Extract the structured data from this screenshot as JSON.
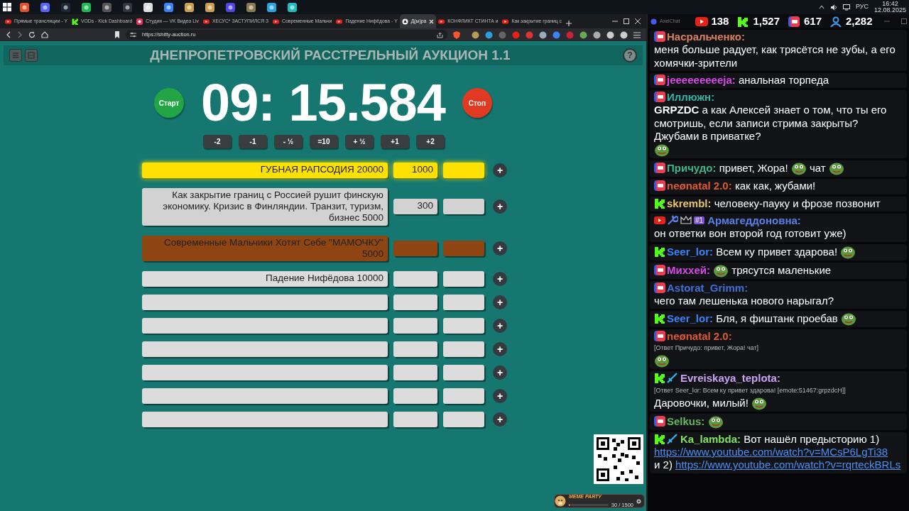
{
  "taskbar": {
    "tray": {
      "language": "РУС",
      "time": "16:42",
      "date": "12.08.2025"
    }
  },
  "browser": {
    "tabs": [
      {
        "kind": "youtube",
        "title": "Прямые трансляции - Y",
        "selected": false
      },
      {
        "kind": "kick",
        "title": "VODs - Kick Dashboard",
        "selected": false
      },
      {
        "kind": "vk",
        "title": "Студия — VK Видео Liv",
        "selected": false
      },
      {
        "kind": "youtube",
        "title": "ХЕСУС* ЗАСТУПИЛСЯ З",
        "selected": false
      },
      {
        "kind": "youtube",
        "title": "Современные Мальчи",
        "selected": false
      },
      {
        "kind": "youtube",
        "title": "Падение Нифёдова - Y",
        "selected": false
      },
      {
        "kind": "page",
        "title": "Д(ы)ра",
        "selected": true
      },
      {
        "kind": "youtube",
        "title": "КОНФЛИКТ СТИНТА и",
        "selected": false
      },
      {
        "kind": "youtube",
        "title": "Как закрытие границ с",
        "selected": false
      }
    ],
    "url": "https://shitty-auction.ru"
  },
  "auction": {
    "title": "ДНЕПРОПЕТРОВСКИЙ РАССТРЕЛЬНЫЙ АУКЦИОН 1.1",
    "help": "?",
    "start_button": "Старт",
    "timer": "09: 15.584",
    "stop_button": "Стоп",
    "time_buttons": [
      "-2",
      "-1",
      "- ½",
      "=10",
      "+ ½",
      "+1",
      "+2"
    ],
    "lots": [
      {
        "name": "ГУБНАЯ РАПСОДИЯ 20000",
        "amount": "1000",
        "color": "#ffe100",
        "add": "+"
      },
      {
        "name": "Как закрытие границ с Россией рушит финскую экономику. Кризис в Финляндии. Транзит, туризм, бизнес 5000",
        "amount": "300",
        "color": "#d2d2d2",
        "add": "+"
      },
      {
        "name": "Современные Мальчики Хотят Себе \"МАМОЧКУ\" 5000",
        "color": "#8f4512",
        "add": "+"
      },
      {
        "name": "Падение Нифёдова 10000",
        "color": "#dcdcdc",
        "add": "+"
      },
      {
        "color": "#dcdcdc",
        "add": "+"
      },
      {
        "color": "#dcdcdc",
        "add": "+"
      },
      {
        "color": "#dcdcdc",
        "add": "+"
      },
      {
        "color": "#dcdcdc",
        "add": "+"
      },
      {
        "color": "#dcdcdc",
        "add": "+"
      },
      {
        "color": "#dcdcdc",
        "add": "+"
      }
    ]
  },
  "widget": {
    "title": "MEME PARTY",
    "progress": "30 / 1500",
    "level": 0.02
  },
  "chat": {
    "title": "AxelChat",
    "stats": [
      {
        "kind": "youtube",
        "count": "138"
      },
      {
        "kind": "kick",
        "count": "1,527"
      },
      {
        "kind": "live",
        "count": "617"
      },
      {
        "kind": "viewers",
        "count": "2,282"
      }
    ],
    "messages": [
      {
        "kind": "live",
        "author": "Насральченко:",
        "color": "#d9805f",
        "parts": [
          {
            "kind": "text",
            "text": "меня больше радует, как трясётся не зубы, а его хомячки-зрители"
          }
        ]
      },
      {
        "kind": "live",
        "author": "jeeeeeeeeeja:",
        "color": "#d64be8",
        "parts": [
          {
            "kind": "text",
            "text": "анальная торпеда"
          }
        ]
      },
      {
        "kind": "live",
        "author": "Иллюжн:",
        "color": "#2fb5a2",
        "parts": [
          {
            "kind": "text",
            "text": "**GRPZDC** а как Алексей знает о том, что ты его смотришь, если записи стрима закрыты? Джубами в приватке?"
          },
          {
            "kind": "emote"
          }
        ]
      },
      {
        "kind": "live",
        "author": "Причудо:",
        "color": "#3fb68b",
        "parts": [
          {
            "kind": "text",
            "text": "привет, Жора!"
          },
          {
            "kind": "emote"
          },
          {
            "kind": "text",
            "text": "чат"
          },
          {
            "kind": "emote"
          }
        ]
      },
      {
        "kind": "live",
        "author": "neønatal 2.0:",
        "color": "#e0582e",
        "parts": [
          {
            "kind": "text",
            "text": "как как, жубами!"
          }
        ]
      },
      {
        "kind": "kick",
        "author": "skrembl:",
        "color": "#e8c46a",
        "parts": [
          {
            "kind": "text",
            "text": "человеку-пауку и фрозе позвонит"
          }
        ]
      },
      {
        "kind": "youtube",
        "author": "Армагеддоновна:",
        "color": "#5b7fe8",
        "badges": [
          {
            "kind": "wrench"
          },
          {
            "kind": "crown"
          },
          {
            "kind": "rank",
            "text": "#1"
          }
        ],
        "parts": [
          {
            "kind": "text",
            "text": "он ответки вон второй год готовит уже)"
          }
        ]
      },
      {
        "kind": "kick",
        "author": "Seer_lor:",
        "color": "#3b82f6",
        "parts": [
          {
            "kind": "text",
            "text": "Всем ку привет здарова!"
          },
          {
            "kind": "emote"
          }
        ]
      },
      {
        "kind": "live",
        "author": "Михxей:",
        "color": "#d64be8",
        "parts": [
          {
            "kind": "emote"
          },
          {
            "kind": "text",
            "text": "трясутся маленькие"
          }
        ]
      },
      {
        "kind": "live",
        "author": "Astorat_Grimm:",
        "color": "#3f70d8",
        "parts": [
          {
            "kind": "text",
            "text": "чего там лешенька нового нарыгал?"
          }
        ]
      },
      {
        "kind": "kick",
        "author": "Seer_lor:",
        "color": "#3b82f6",
        "parts": [
          {
            "kind": "text",
            "text": "Бля, я фиштанк проебав"
          },
          {
            "kind": "emote"
          }
        ]
      },
      {
        "kind": "live",
        "author": "neønatal 2.0:",
        "color": "#e0582e",
        "reply": "[Ответ Причудо: привет, Жора! чат]",
        "parts": [
          {
            "kind": "emote"
          }
        ]
      },
      {
        "kind": "kick",
        "author": "Evreiskaya_teplota:",
        "color": "#c9a3f2",
        "badges": [
          {
            "kind": "sword"
          }
        ],
        "reply": "[Ответ Seer_lor: Всем ку привет здарова! [emote:51467:grpzdcH]]",
        "parts": [
          {
            "kind": "text",
            "text": "Даровочки, милый!"
          },
          {
            "kind": "emote"
          }
        ]
      },
      {
        "kind": "live",
        "author": "Selkus:",
        "color": "#62b85a",
        "parts": [
          {
            "kind": "emote"
          }
        ]
      },
      {
        "kind": "kick",
        "author": "Ka_lambda:",
        "color": "#84e05f",
        "badges": [
          {
            "kind": "sword"
          }
        ],
        "parts": [
          {
            "kind": "text",
            "text": "Вот нашёл предысторию 1)"
          },
          {
            "kind": "link",
            "text": "https://www.youtube.com/watch?v=MCsP6LgTi38"
          },
          {
            "kind": "text",
            "text": "и 2)"
          },
          {
            "kind": "link",
            "text": "https://www.youtube.com/watch?v=rqrteckBRLs"
          }
        ]
      }
    ]
  }
}
